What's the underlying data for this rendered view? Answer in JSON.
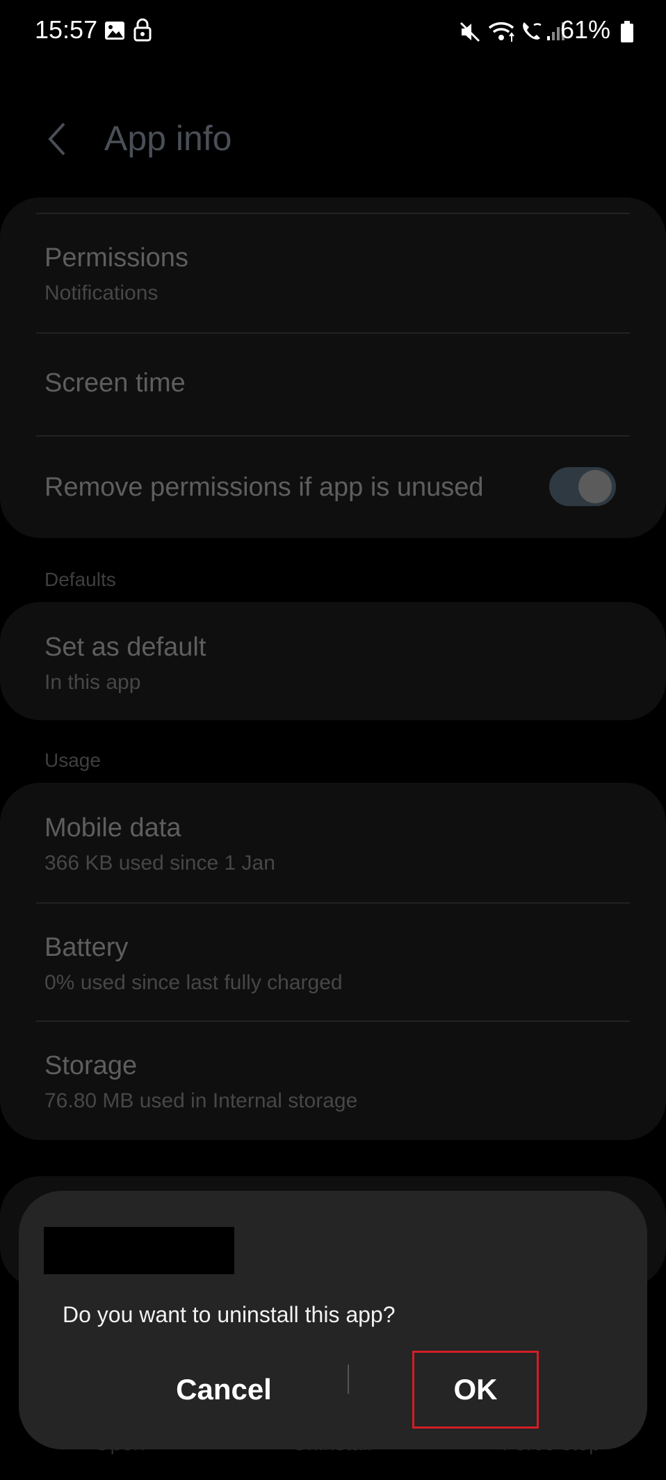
{
  "status_bar": {
    "time": "15:57",
    "battery": "61%"
  },
  "header": {
    "title": "App info"
  },
  "sections": {
    "defaults_label": "Defaults",
    "usage_label": "Usage"
  },
  "rows": {
    "permissions": {
      "title": "Permissions",
      "subtitle": "Notifications"
    },
    "screen_time": {
      "title": "Screen time"
    },
    "remove_permissions": {
      "title": "Remove permissions if app is unused",
      "toggle_on": true
    },
    "set_default": {
      "title": "Set as default",
      "subtitle": "In this app"
    },
    "mobile_data": {
      "title": "Mobile data",
      "subtitle": "366 KB used since 1 Jan"
    },
    "battery": {
      "title": "Battery",
      "subtitle": "0% used since last fully charged"
    },
    "storage": {
      "title": "Storage",
      "subtitle": "76.80 MB used in Internal storage"
    }
  },
  "bottom_actions": {
    "open": "Open",
    "uninstall": "Uninstall",
    "force_stop": "Force stop"
  },
  "dialog": {
    "message": "Do you want to uninstall this app?",
    "cancel": "Cancel",
    "ok": "OK"
  },
  "colors": {
    "background": "#000000",
    "dialog": "#252525",
    "highlight": "#d31d26"
  }
}
